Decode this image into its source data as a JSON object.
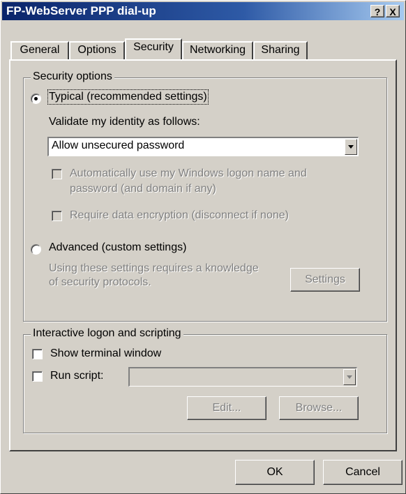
{
  "window": {
    "title": "FP-WebServer PPP dial-up",
    "help_button": "?",
    "close_button": "X"
  },
  "tabs": [
    {
      "label": "General"
    },
    {
      "label": "Options"
    },
    {
      "label": "Security",
      "active": true
    },
    {
      "label": "Networking"
    },
    {
      "label": "Sharing"
    }
  ],
  "security_options": {
    "group_title": "Security options",
    "typical": {
      "label": "Typical (recommended settings)",
      "selected": true
    },
    "validate_label": "Validate my identity as follows:",
    "validate_select": {
      "value": "Allow unsecured password"
    },
    "auto_logon": {
      "line1": "Automatically use my Windows logon name and",
      "line2": "password (and domain if any)",
      "checked": false,
      "enabled": false
    },
    "require_encryption": {
      "label": "Require data encryption (disconnect if none)",
      "checked": false,
      "enabled": false
    },
    "advanced": {
      "label": "Advanced (custom settings)",
      "selected": false
    },
    "advanced_note": {
      "line1": "Using these settings requires a knowledge",
      "line2": "of security protocols."
    },
    "settings_button": "Settings"
  },
  "interactive": {
    "group_title": "Interactive logon and scripting",
    "show_terminal": {
      "label": "Show terminal window",
      "checked": false
    },
    "run_script": {
      "label": "Run script:",
      "checked": false
    },
    "script_select": {
      "value": ""
    },
    "edit_button": "Edit...",
    "browse_button": "Browse..."
  },
  "footer": {
    "ok": "OK",
    "cancel": "Cancel"
  },
  "colors": {
    "face": "#d4d0c8",
    "title_start": "#0a246a",
    "title_end": "#a6caf0",
    "disabled_text": "#808080"
  }
}
